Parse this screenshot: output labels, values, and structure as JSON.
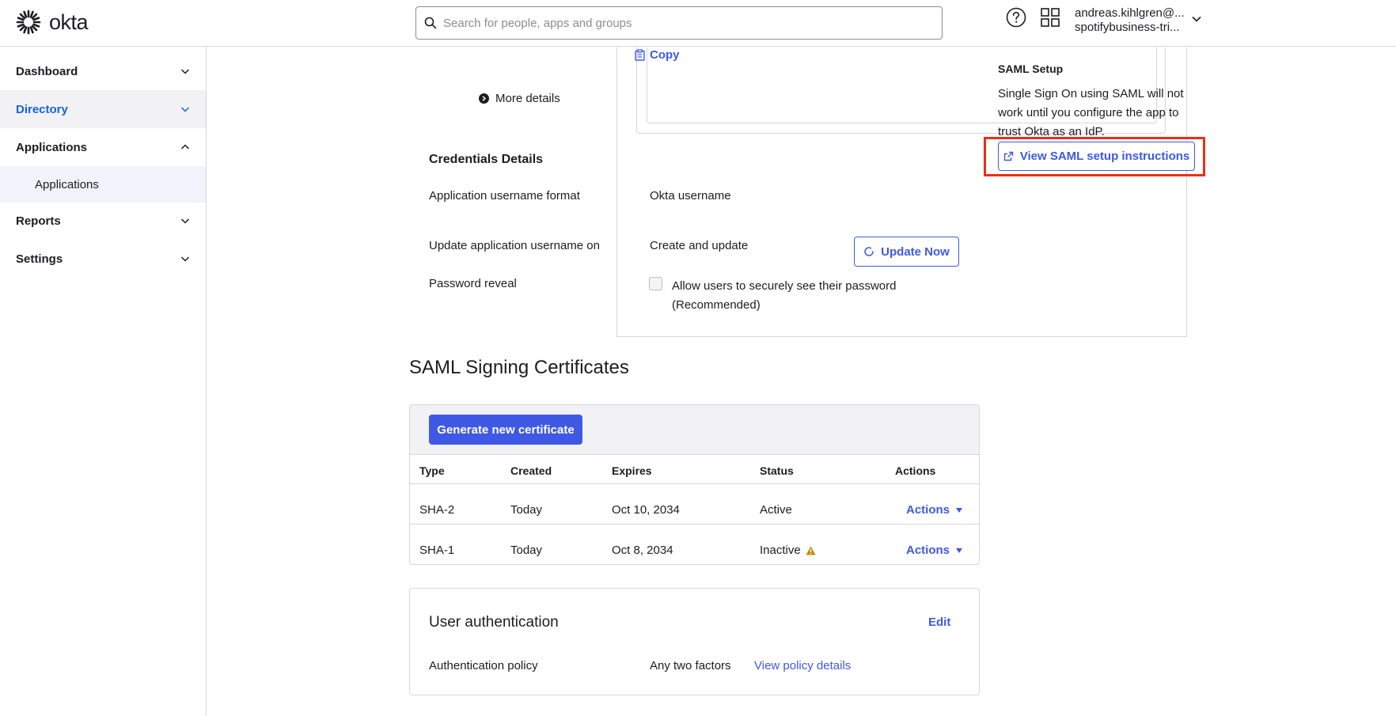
{
  "topbar": {
    "logo_text": "okta",
    "search_placeholder": "Search for people, apps and groups",
    "user_email": "andreas.kihlgren@...",
    "user_org": "spotifybusiness-tri..."
  },
  "sidebar": {
    "items": [
      {
        "label": "Dashboard"
      },
      {
        "label": "Directory"
      },
      {
        "label": "Applications"
      },
      {
        "label": "Applications"
      },
      {
        "label": "Reports"
      },
      {
        "label": "Settings"
      }
    ]
  },
  "sign_on": {
    "copy_label": "Copy",
    "more_details": "More details"
  },
  "credentials": {
    "heading": "Credentials Details",
    "rows": [
      {
        "label": "Application username format",
        "value": "Okta username"
      },
      {
        "label": "Update application username on",
        "value": "Create and update"
      },
      {
        "label": "Password reveal",
        "value": "Allow users to securely see their password",
        "value2": "(Recommended)"
      }
    ],
    "update_button": "Update Now"
  },
  "certificates": {
    "heading": "SAML Signing Certificates",
    "generate_button": "Generate new certificate",
    "columns": [
      "Type",
      "Created",
      "Expires",
      "Status",
      "Actions"
    ],
    "rows": [
      {
        "type": "SHA-2",
        "created": "Today",
        "expires": "Oct 10, 2034",
        "status": "Active",
        "action": "Actions"
      },
      {
        "type": "SHA-1",
        "created": "Today",
        "expires": "Oct 8, 2034",
        "status": "Inactive",
        "action": "Actions"
      }
    ]
  },
  "user_auth": {
    "heading": "User authentication",
    "edit_label": "Edit",
    "policy_label": "Authentication policy",
    "policy_value": "Any two factors",
    "policy_link": "View policy details"
  },
  "saml_setup": {
    "title": "SAML Setup",
    "description": "Single Sign On using SAML will not work until you configure the app to trust Okta as an IdP.",
    "button_label": "View SAML setup instructions"
  },
  "colors": {
    "accent": "#3f59e4",
    "active_nav": "#1662dd",
    "highlight": "#ec2f14",
    "warning": "#c48a00"
  }
}
